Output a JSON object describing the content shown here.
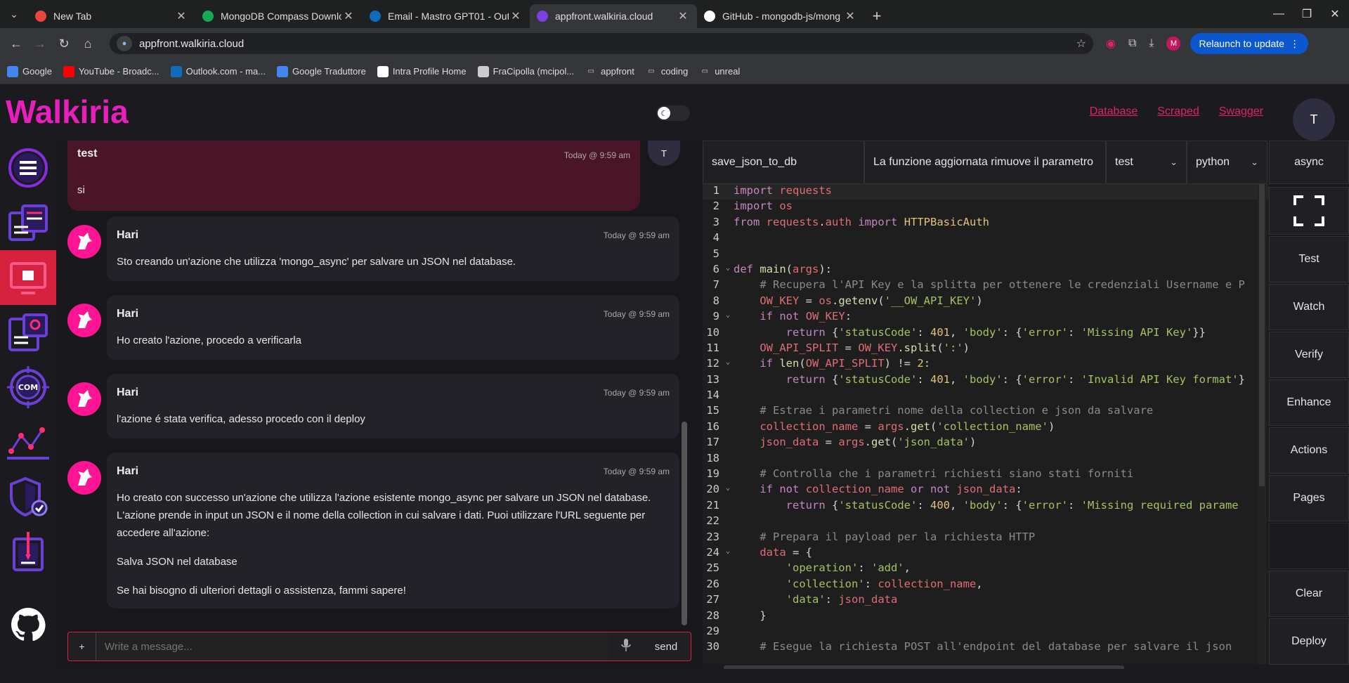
{
  "browser": {
    "tabs": [
      {
        "title": "New Tab",
        "color": "#e8453c"
      },
      {
        "title": "MongoDB Compass Downloa",
        "color": "#13aa52"
      },
      {
        "title": "Email - Mastro GPT01 - Outlo",
        "color": "#0f6cbd"
      },
      {
        "title": "appfront.walkiria.cloud",
        "color": "#7b3fe4"
      },
      {
        "title": "GitHub - mongodb-js/mong",
        "color": "#ffffff"
      }
    ],
    "url": "appfront.walkiria.cloud",
    "relaunch_label": "Relaunch to update",
    "profile_initial": "M",
    "bookmarks": [
      {
        "label": "Google",
        "color": "#4285f4"
      },
      {
        "label": "YouTube - Broadc...",
        "color": "#ff0000"
      },
      {
        "label": "Outlook.com - ma...",
        "color": "#0f6cbd"
      },
      {
        "label": "Google Traduttore",
        "color": "#4285f4"
      },
      {
        "label": "Intra Profile Home",
        "color": "#ffffff"
      },
      {
        "label": "FraCipolla (mcipol...",
        "color": "#cccccc"
      },
      {
        "label": "appfront",
        "color": "folder"
      },
      {
        "label": "coding",
        "color": "folder"
      },
      {
        "label": "unreal",
        "color": "folder"
      }
    ]
  },
  "app": {
    "brand": "Walkiria",
    "brand_color": "#e81fbd",
    "header_links": [
      "Database",
      "Scraped",
      "Swagger"
    ],
    "user_initial": "T",
    "accent": "#d6213f"
  },
  "sidebar": {
    "items": [
      {
        "icon": "menu-icon"
      },
      {
        "icon": "documents-icon"
      },
      {
        "icon": "monitor-icon",
        "active": true
      },
      {
        "icon": "tools-icon"
      },
      {
        "icon": "com-target-icon"
      },
      {
        "icon": "analytics-icon"
      },
      {
        "icon": "shield-check-icon"
      },
      {
        "icon": "notebook-icon"
      },
      {
        "icon": "github-icon"
      }
    ]
  },
  "chat": {
    "messages": [
      {
        "author": "test",
        "time": "Today @ 9:59 am",
        "text": "si",
        "user": true,
        "initial": "T"
      },
      {
        "author": "Hari",
        "time": "Today @ 9:59 am",
        "text": "Sto creando un'azione che utilizza 'mongo_async' per salvare un JSON nel database."
      },
      {
        "author": "Hari",
        "time": "Today @ 9:59 am",
        "text": "Ho creato l'azione, procedo a verificarla"
      },
      {
        "author": "Hari",
        "time": "Today @ 9:59 am",
        "text": "l'azione é stata verifica, adesso procedo con il deploy"
      },
      {
        "author": "Hari",
        "time": "Today @ 9:59 am",
        "text": "Ho creato con successo un'azione che utilizza l'azione esistente mongo_async per salvare un JSON nel database. L'azione prende in input un JSON e il nome della collection in cui salvare i dati. Puoi utilizzare l'URL seguente per accedere all'azione:",
        "text2": "Salva JSON nel database",
        "text3": "Se hai bisogno di ulteriori dettagli o assistenza, fammi sapere!"
      }
    ],
    "composer": {
      "placeholder": "Write a message...",
      "plus": "+",
      "send": "send"
    }
  },
  "editor": {
    "action_name": "save_json_to_db",
    "description": "La funzione aggiornata rimuove il parametro",
    "package": "test",
    "language": "python",
    "mode": "async",
    "buttons": [
      "Test",
      "Watch",
      "Verify",
      "Enhance",
      "Actions",
      "Pages",
      "Clear",
      "Deploy"
    ],
    "fold_lines": [
      6,
      9,
      12,
      20,
      24
    ],
    "code": [
      "import requests",
      "import os",
      "from requests.auth import HTTPBasicAuth",
      "",
      "",
      "def main(args):",
      "    # Recupera l'API Key e la splitta per ottenere le credenziali Username e P",
      "    OW_KEY = os.getenv('__OW_API_KEY')",
      "    if not OW_KEY:",
      "        return {'statusCode': 401, 'body': {'error': 'Missing API Key'}}",
      "    OW_API_SPLIT = OW_KEY.split(':')",
      "    if len(OW_API_SPLIT) != 2:",
      "        return {'statusCode': 401, 'body': {'error': 'Invalid API Key format'}",
      "",
      "    # Estrae i parametri nome della collection e json da salvare",
      "    collection_name = args.get('collection_name')",
      "    json_data = args.get('json_data')",
      "",
      "    # Controlla che i parametri richiesti siano stati forniti",
      "    if not collection_name or not json_data:",
      "        return {'statusCode': 400, 'body': {'error': 'Missing required parame",
      "",
      "    # Prepara il payload per la richiesta HTTP",
      "    data = {",
      "        'operation': 'add',",
      "        'collection': collection_name,",
      "        'data': json_data",
      "    }",
      "",
      "    # Esegue la richiesta POST all'endpoint del database per salvare il json"
    ]
  }
}
